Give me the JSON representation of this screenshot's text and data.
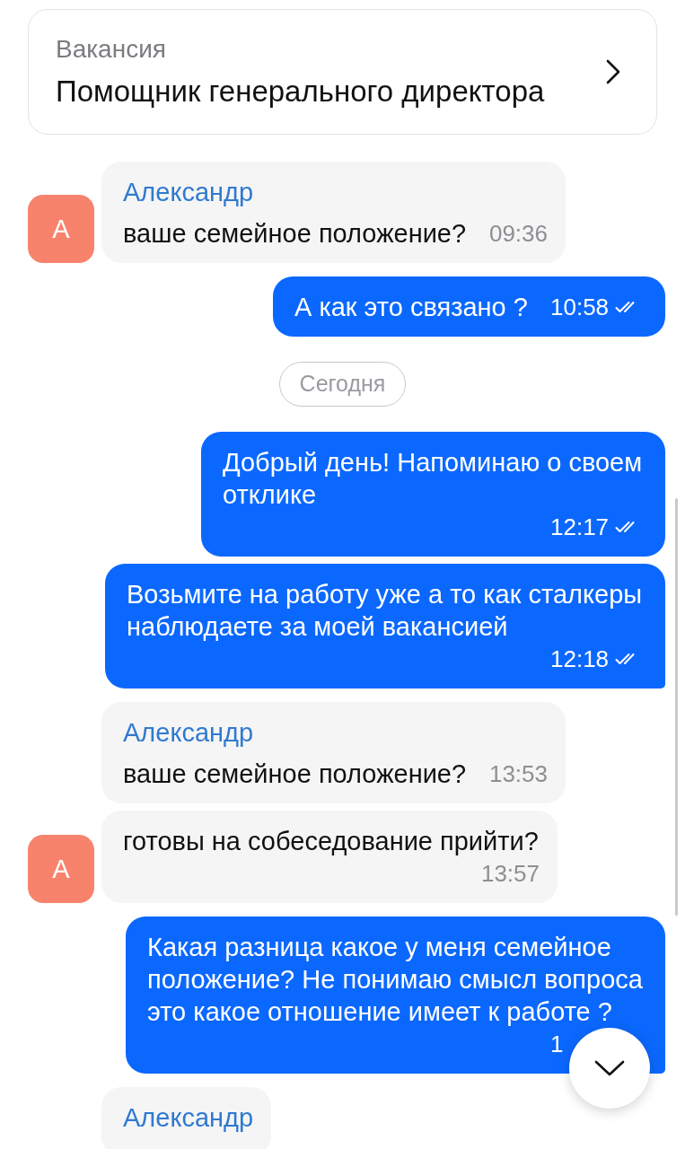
{
  "vacancy": {
    "label": "Вакансия",
    "title": "Помощник генерального директора"
  },
  "messages": [
    {
      "kind": "incoming",
      "sender": "Александр",
      "avatar": "А",
      "text": "ваше семейное положение?",
      "time": "09:36"
    },
    {
      "kind": "outgoing",
      "text": "А как это связано ?",
      "time": "10:58",
      "read": true,
      "tail": false
    },
    {
      "kind": "date",
      "text": "Сегодня"
    },
    {
      "kind": "outgoing",
      "text": "Добрый день! Напоминаю о своем отклике",
      "time": "12:17",
      "read": true,
      "tail": false
    },
    {
      "kind": "outgoing",
      "text": "Возьмите на работу уже а то как сталкеры наблюдаете за моей вакансией",
      "time": "12:18",
      "read": true,
      "tail": true
    },
    {
      "kind": "incoming",
      "sender": "Александр",
      "text": "ваше семейное положение?",
      "time": "13:53"
    },
    {
      "kind": "incoming",
      "avatar": "А",
      "text": "готовы на собеседование прийти?",
      "time": "13:57"
    },
    {
      "kind": "outgoing",
      "text": "Какая разница какое у меня семейное положение? Не понимаю смысл вопроса это какое отношение имеет к работе ?",
      "time": "1",
      "tail": true
    },
    {
      "kind": "incoming",
      "sender": "Александр"
    }
  ]
}
